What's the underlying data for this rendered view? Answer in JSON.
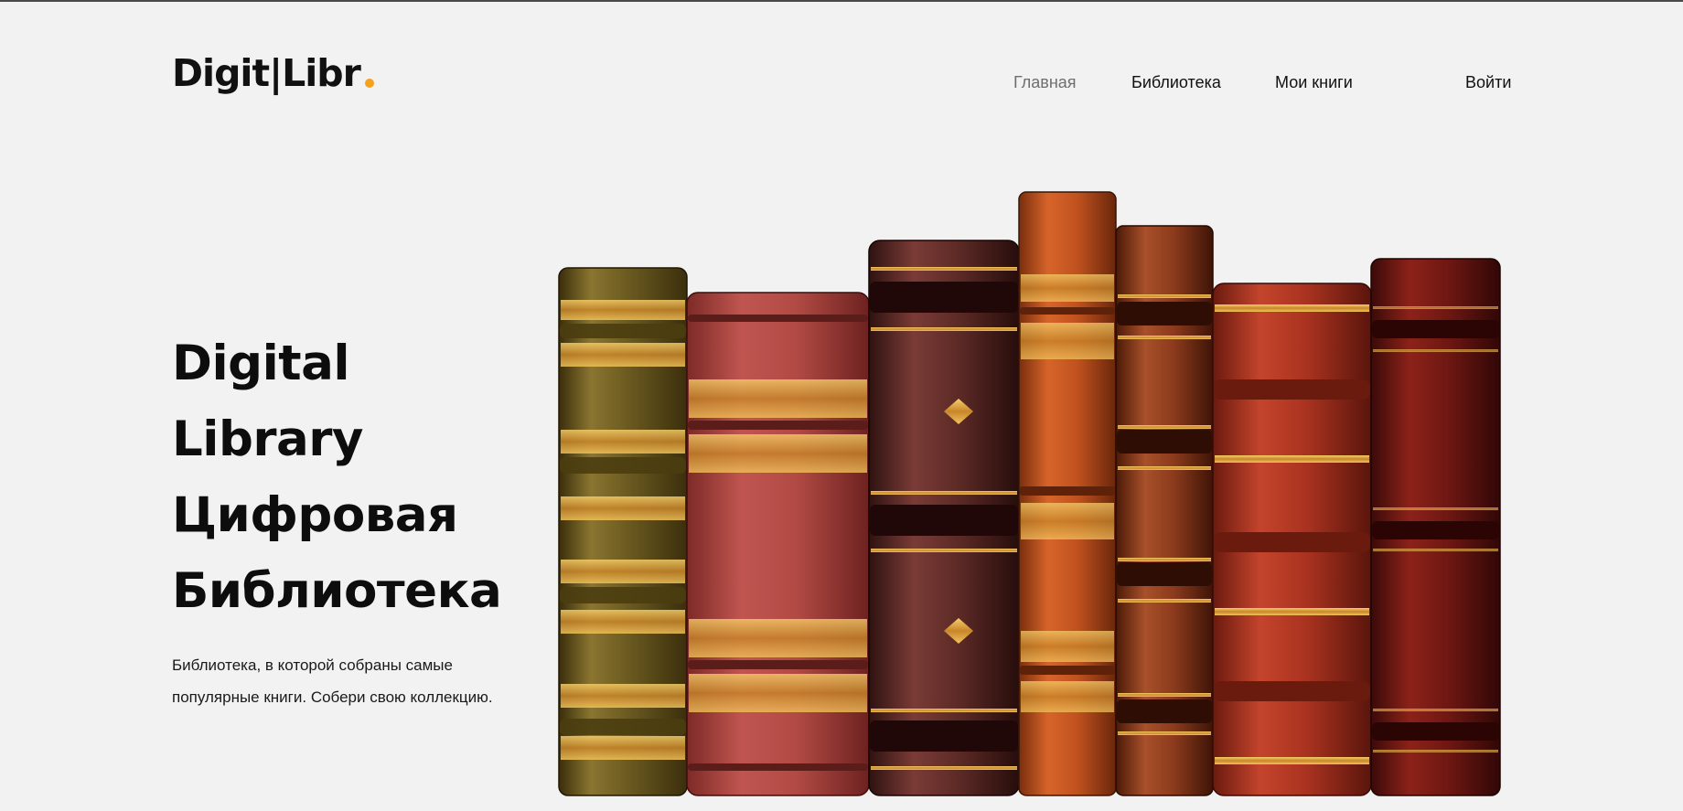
{
  "header": {
    "logo": "Digit|Libr",
    "nav": {
      "home": "Главная",
      "library": "Библиотека",
      "my_books": "Мои книги",
      "login": "Войти"
    }
  },
  "hero": {
    "title_lines": [
      "Digital",
      "Library",
      "Цифровая",
      "Библиотека"
    ],
    "description": "Библиотека, в которой собраны самые популярные книги. Собери свою коллекцию."
  },
  "colors": {
    "background": "#f2f2f2",
    "accent": "#f4a11d",
    "nav_active": "#6e6e6e"
  },
  "illustration": {
    "name": "books-illustration",
    "books": [
      {
        "name": "book-olive",
        "color": "#6b5a1e"
      },
      {
        "name": "book-rose",
        "color": "#b24a44"
      },
      {
        "name": "book-maroon",
        "color": "#5c2a26"
      },
      {
        "name": "book-orange",
        "color": "#c0521f"
      },
      {
        "name": "book-brown",
        "color": "#8b3a1c"
      },
      {
        "name": "book-red",
        "color": "#a8321f"
      },
      {
        "name": "book-darkred",
        "color": "#6e1712"
      }
    ]
  }
}
